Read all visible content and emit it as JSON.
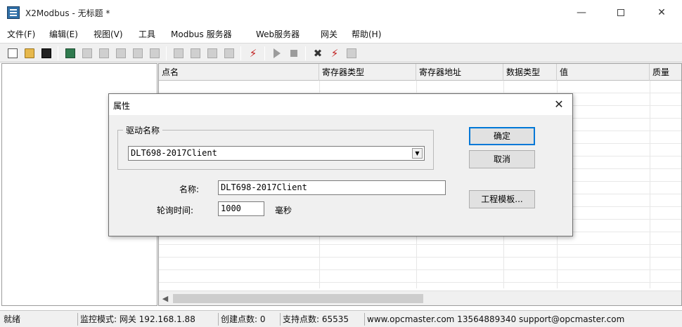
{
  "window": {
    "title": "X2Modbus - 无标题 *",
    "min_glyph": "—",
    "close_glyph": "✕"
  },
  "menu": [
    "文件(F)",
    "编辑(E)",
    "视图(V)",
    "工具",
    "Modbus 服务器",
    "Web服务器",
    "网关",
    "帮助(H)"
  ],
  "toolbar": {
    "icons": [
      "new-file-icon",
      "open-folder-icon",
      "save-icon",
      "add-device-icon",
      "rename-icon",
      "properties-icon",
      "new-group-icon",
      "copy-group-icon",
      "paste-group-icon",
      "cut-icon",
      "copy-icon",
      "paste-icon",
      "delete-icon",
      "monitor-icon",
      "run-icon",
      "stop-icon",
      "tools-icon",
      "plugin-icon",
      "config-icon"
    ]
  },
  "grid": {
    "columns": [
      "点名",
      "寄存器类型",
      "寄存器地址",
      "数据类型",
      "值",
      "质量"
    ],
    "row_count": 16
  },
  "dialog": {
    "title": "属性",
    "close_glyph": "✕",
    "driver_group_label": "驱动名称",
    "driver_value": "DLT698-2017Client",
    "name_label": "名称:",
    "name_value": "DLT698-2017Client",
    "poll_label": "轮询时间:",
    "poll_value": "1000",
    "poll_unit": "毫秒",
    "ok_label": "确定",
    "cancel_label": "取消",
    "template_label": "工程模板..."
  },
  "statusbar": {
    "ready": "就绪",
    "monitor_mode": "监控模式: 网关 192.168.1.88",
    "created_points": "创建点数: 0",
    "supported_points": "支持点数: 65535",
    "contact": "www.opcmaster.com 13564889340 support@opcmaster.com"
  }
}
